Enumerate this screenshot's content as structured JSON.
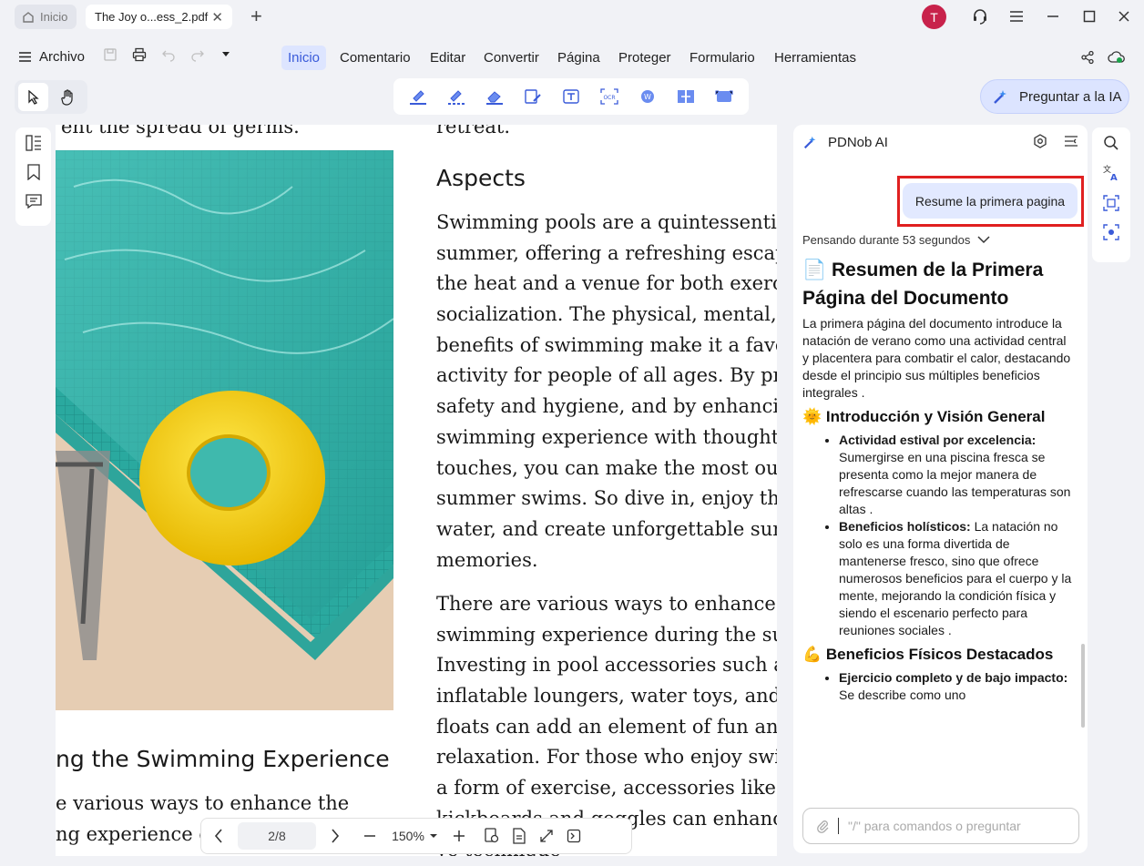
{
  "tabs": {
    "home_label": "Inicio",
    "doc_label": "The Joy o...ess_2.pdf"
  },
  "user": {
    "avatar_initial": "T"
  },
  "menu": {
    "archivo": "Archivo",
    "items": [
      "Inicio",
      "Comentario",
      "Editar",
      "Convertir",
      "Página",
      "Proteger",
      "Formulario",
      "Herramientas"
    ],
    "active_index": 0
  },
  "ask_ai_button": "Preguntar a la IA",
  "document": {
    "top_left_fragment": "ent the spread of germs.",
    "top_right_fragment": "retreat.",
    "heading_right": "Aspects",
    "right_para1": [
      "Swimming pools are a quintessential",
      "summer, offering a refreshing escape",
      "the heat and a venue for both exercis",
      "socialization. The physical, mental, ar",
      "benefits of swimming make it a favor",
      "activity for people of all ages. By prio",
      "safety and hygiene, and by enhancing",
      "swimming experience with thoughtfu",
      "touches, you can make the most out o",
      "summer swims. So dive in, enjoy the",
      "water, and create unforgettable summ",
      "memories."
    ],
    "right_para2": [
      "There are various ways to enhance th",
      "swimming experience during the sun",
      "Investing in pool accessories such as",
      "inflatable loungers, water toys, and p",
      "floats can add an element of fun and",
      "relaxation. For those who enjoy swim",
      "a form of exercise, accessories like sv",
      "kickboards and goggles can enhance",
      "ve technique"
    ],
    "heading_left": "ng the Swimming Experience",
    "left_para": [
      "e various ways to enhance the",
      "ng experience du"
    ]
  },
  "pagination": {
    "page": "2/8",
    "zoom": "150%"
  },
  "ai_panel": {
    "title": "PDNob AI",
    "user_message": "Resume la primera pagina",
    "thinking": "Pensando durante 53 segundos",
    "h1": "Resumen de la Primera Página del Documento",
    "h1_emoji": "📄",
    "intro": "La primera página del documento introduce la natación de verano como una actividad central y placentera para combatir el calor, destacando desde el principio sus múltiples beneficios integrales .",
    "section1_emoji": "🌞",
    "section1": "Introducción y Visión General",
    "s1_items": [
      {
        "bold": "Actividad estival por excelencia:",
        "text": " Sumergirse en una piscina fresca se presenta como la mejor manera de refrescarse cuando las temperaturas son altas ."
      },
      {
        "bold": "Beneficios holísticos:",
        "text": " La natación no solo es una forma divertida de mantenerse fresco, sino que ofrece numerosos beneficios para el cuerpo y la mente, mejorando la condición física y siendo el escenario perfecto para reuniones sociales ."
      }
    ],
    "section2_emoji": "💪",
    "section2": "Beneficios Físicos Destacados",
    "s2_items": [
      {
        "bold": "Ejercicio completo y de bajo impacto:",
        "text": " Se describe como uno"
      }
    ],
    "input_placeholder": "\"/\" para comandos o preguntar"
  },
  "colors": {
    "accent": "#3a5bd9",
    "highlight_box": "#e02020",
    "user_bubble": "#e2e9ff",
    "avatar": "#c8224b",
    "pool_water": "#2fb3a8",
    "float_yellow": "#f5d01a"
  }
}
